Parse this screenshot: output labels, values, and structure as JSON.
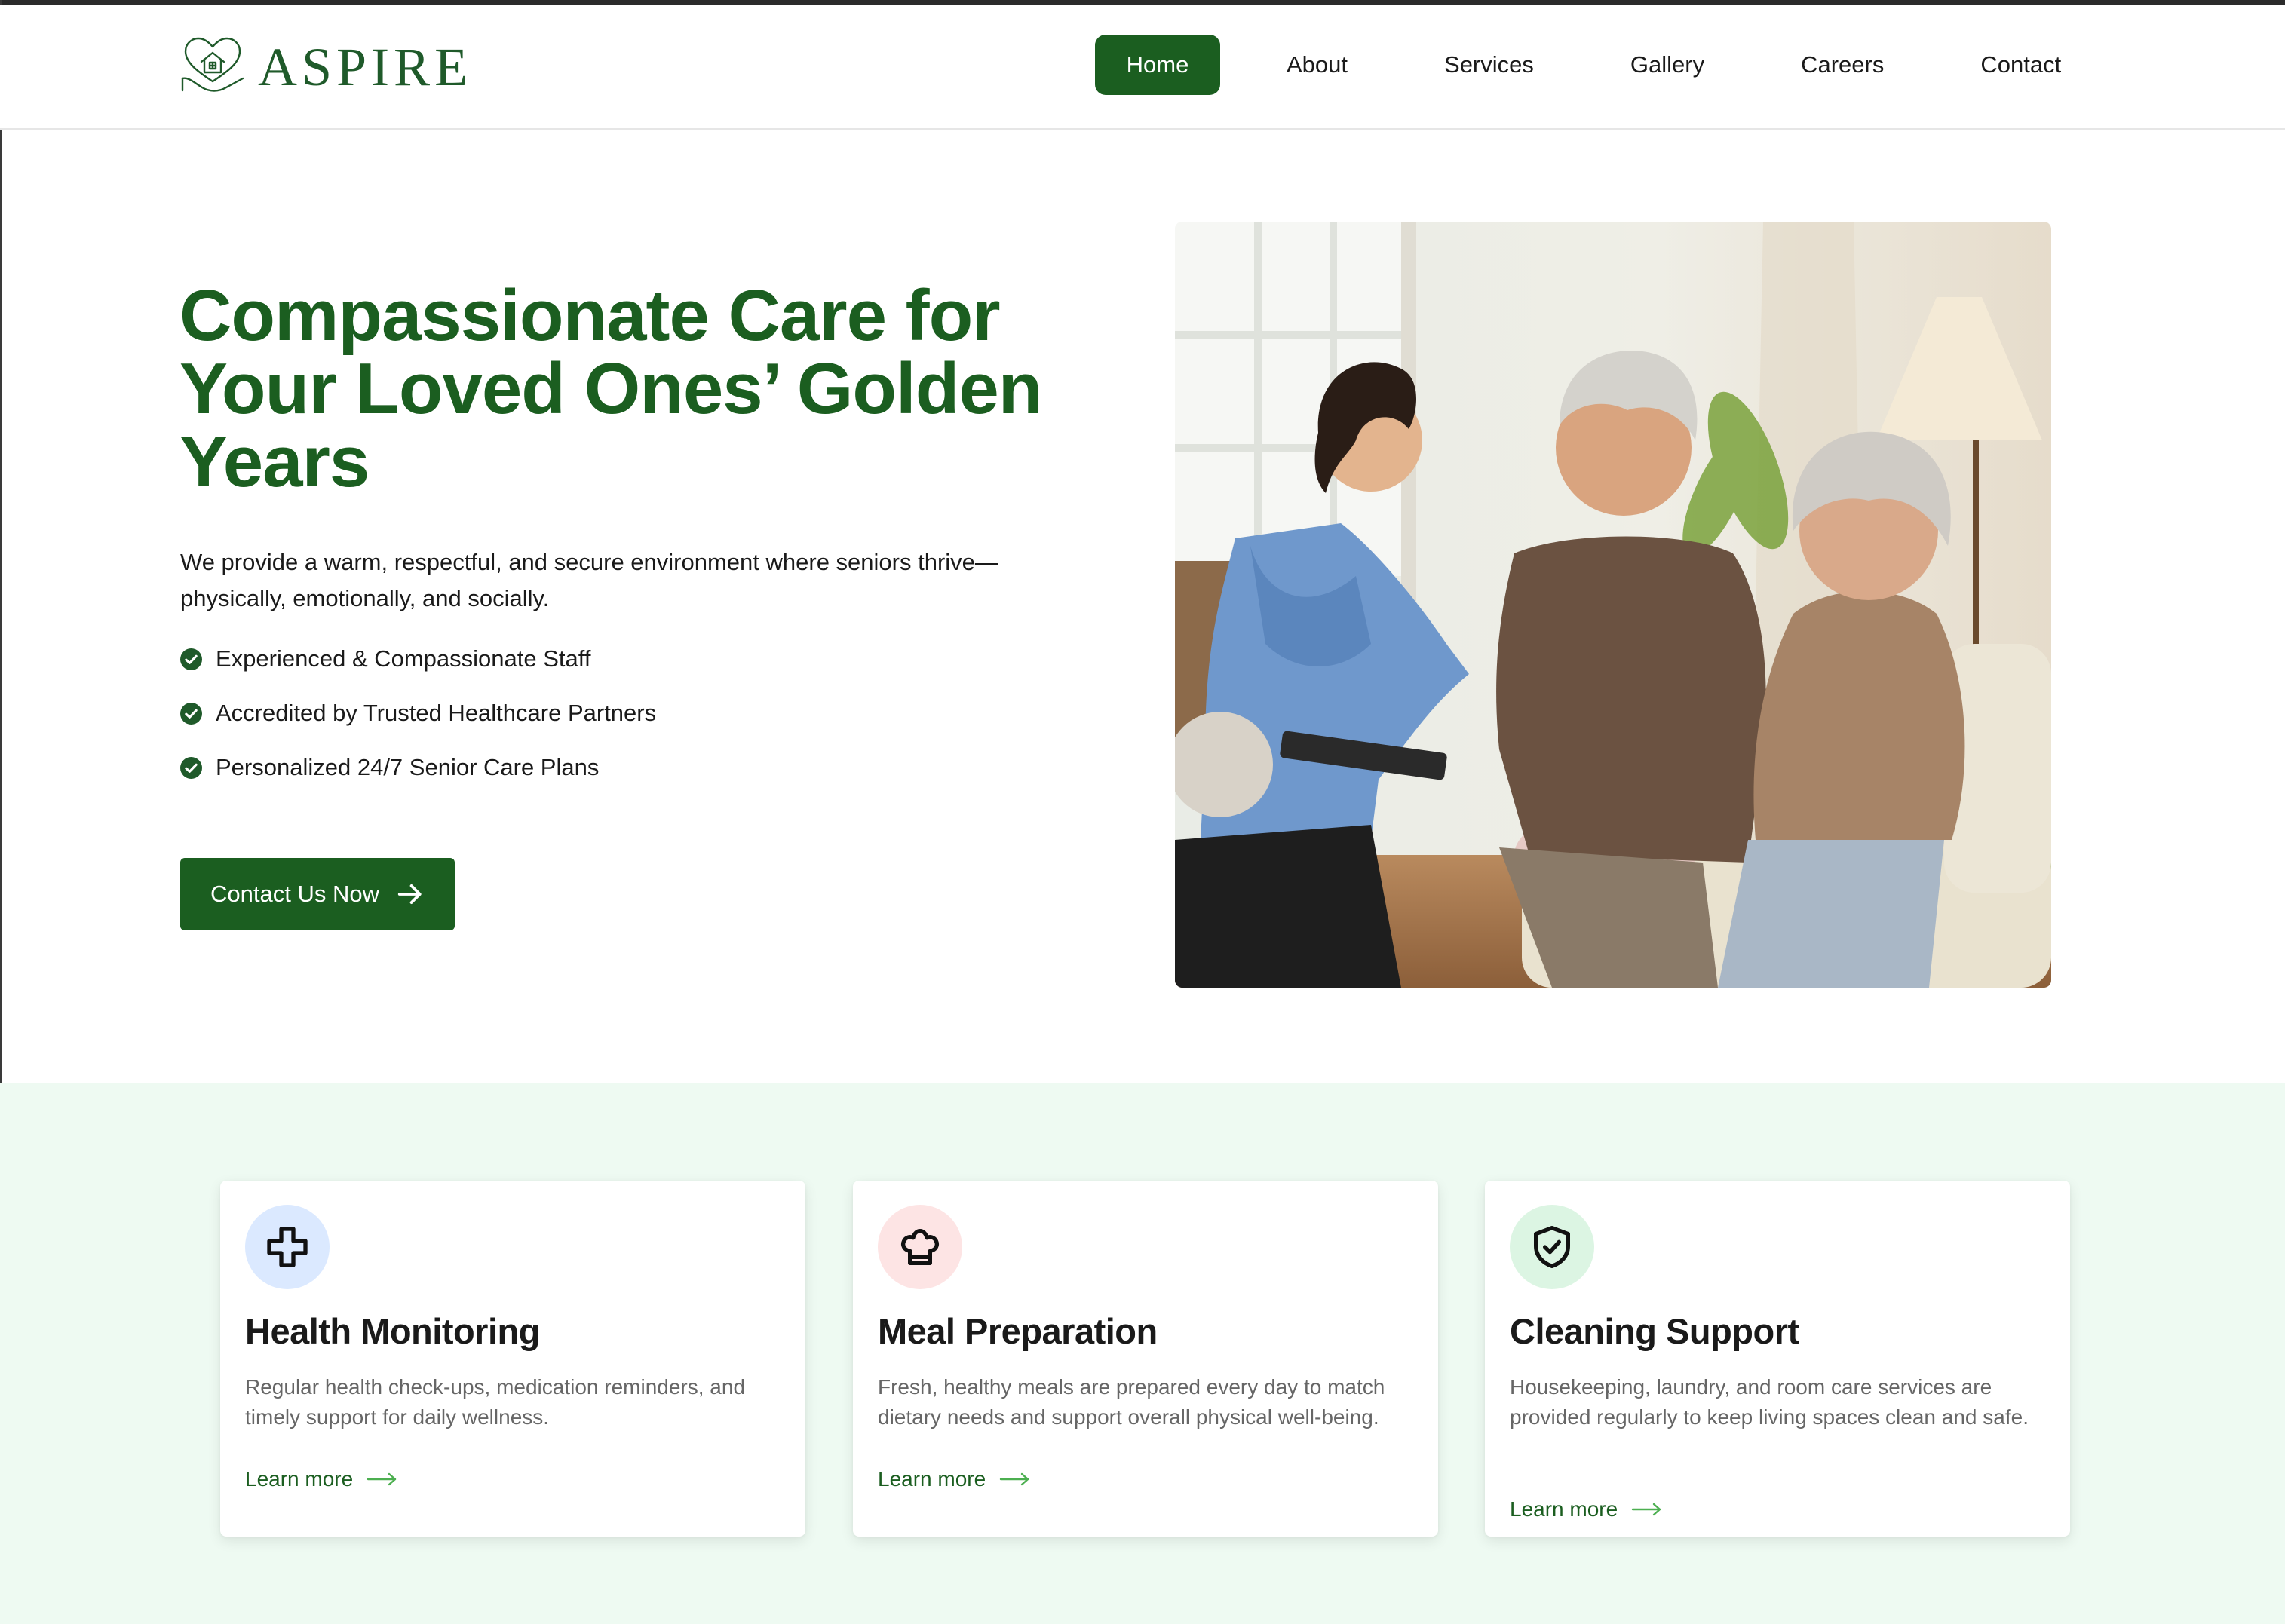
{
  "brand": {
    "name": "ASPIRE",
    "primary_color": "#1b5e20",
    "accent_color": "#4caf50",
    "section_bg": "#eefaf2"
  },
  "nav": {
    "items": [
      {
        "label": "Home",
        "active": true
      },
      {
        "label": "About"
      },
      {
        "label": "Services"
      },
      {
        "label": "Gallery"
      },
      {
        "label": "Careers"
      },
      {
        "label": "Contact"
      }
    ]
  },
  "hero": {
    "title": "Compassionate Care for Your Loved Ones’ Golden Years",
    "description": "We provide a warm, respectful, and secure environment where seniors thrive—physically, emotionally, and socially.",
    "features": [
      "Experienced & Compassionate Staff",
      "Accredited by Trusted Healthcare Partners",
      "Personalized 24/7 Senior Care Plans"
    ],
    "cta_label": "Contact Us Now",
    "image_icon": "photo-caregiver-checking-elderly-man"
  },
  "services": [
    {
      "icon": "medical-cross-icon",
      "icon_bg": "#dbe9ff",
      "title": "Health Monitoring",
      "description": "Regular health check-ups, medication reminders, and timely support for daily wellness.",
      "link": "Learn more"
    },
    {
      "icon": "chef-hat-icon",
      "icon_bg": "#fde4e4",
      "title": "Meal Preparation",
      "description": "Fresh, healthy meals are prepared every day to match dietary needs and support overall physical well-being.",
      "link": "Learn more"
    },
    {
      "icon": "shield-check-icon",
      "icon_bg": "#dcf5e3",
      "title": "Cleaning Support",
      "description": "Housekeeping, laundry, and room care services are provided regularly to keep living spaces clean and safe.",
      "link": "Learn more"
    }
  ]
}
